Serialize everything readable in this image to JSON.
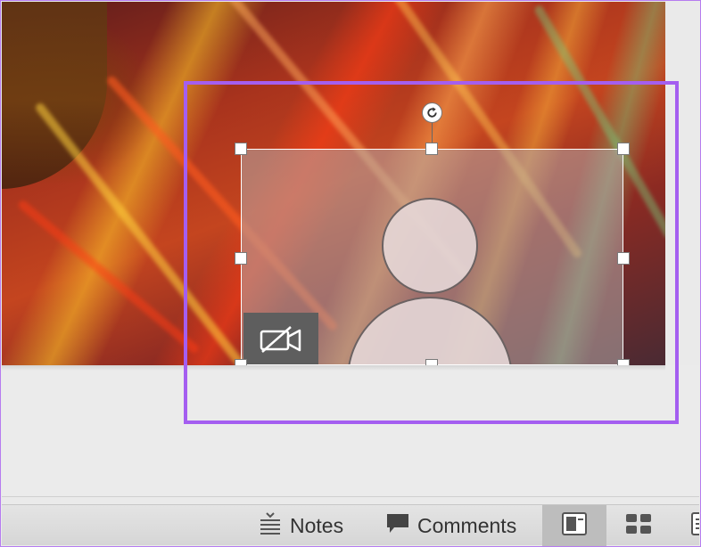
{
  "slide": {
    "background": "abstract-light-streaks",
    "cameo_placeholder": {
      "avatar_icon": "person-icon",
      "camera_icon": "camera-off-icon"
    }
  },
  "status_bar": {
    "notes_label": "Notes",
    "notes_icon": "notes-icon",
    "comments_label": "Comments",
    "comments_icon": "comment-bubble-icon",
    "views": [
      {
        "name": "normal-view",
        "active": true
      },
      {
        "name": "slide-sorter-view",
        "active": false
      },
      {
        "name": "reading-view",
        "active": false
      }
    ]
  },
  "colors": {
    "highlight": "#a45ef0",
    "statusbar_bg": "#d9d9d9",
    "active_view_bg": "#bdbdbd"
  }
}
